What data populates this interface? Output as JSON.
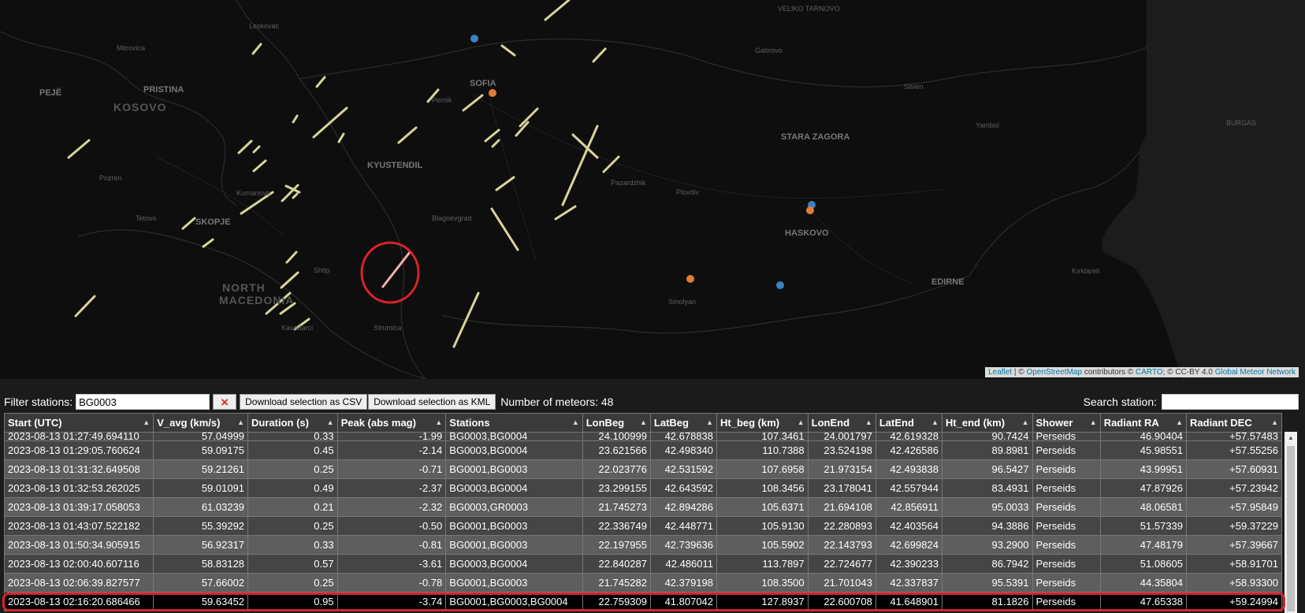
{
  "map": {
    "attribution": {
      "leaflet": "Leaflet",
      "sep1": " | © ",
      "osm": "OpenStreetMap",
      "contributors": " contributors © ",
      "carto": "CARTO",
      "license": "; © CC-BY 4.0 ",
      "gmn": "Global Meteor Network"
    },
    "labels": {
      "veliko": "VELIKO TARNOVO",
      "leskovac": "Leskovac",
      "mitrovica": "Mitrovica",
      "gabrovo": "Gabrovo",
      "pristina": "PRISTINA",
      "peje": "PEJË",
      "kosovo": "KOSOVO",
      "sofia": "SOFIA",
      "pernik": "Pernik",
      "sliven": "Sliven",
      "burgas": "BURGAS",
      "yambol": "Yambol",
      "stara": "STARA ZAGORA",
      "kyustendil": "KYUSTENDIL",
      "prizren": "Prizren",
      "kumanovo": "Kumanovo",
      "pazardzhik": "Pazardzhik",
      "plovdiv": "Plovdiv",
      "tetovo": "Tetovo",
      "skopje": "SKOPJE",
      "blagoevgrad": "Blagoevgrad",
      "haskovo": "HASKOVO",
      "shtip": "Shtip",
      "north": "NORTH",
      "macedonia": "MACEDONIA",
      "edirne": "EDIRNE",
      "kirklareli": "Kırklareli",
      "smolyan": "Smolyan",
      "kavadarci": "Kavadarci",
      "strumica": "Strumica"
    }
  },
  "toolbar": {
    "filter_label": "Filter stations:",
    "filter_value": "BG0003",
    "clear_icon": "×",
    "csv_button": "Download selection as CSV",
    "kml_button": "Download selection as KML",
    "count_text": "Number of meteors: 48",
    "search_label": "Search station:",
    "search_value": ""
  },
  "table": {
    "headers": [
      "Start (UTC)",
      "V_avg (km/s)",
      "Duration (s)",
      "Peak (abs mag)",
      "Stations",
      "LonBeg",
      "LatBeg",
      "Ht_beg (km)",
      "LonEnd",
      "LatEnd",
      "Ht_end (km)",
      "Shower",
      "Radiant RA",
      "Radiant DEC"
    ],
    "sort_icon": "▲",
    "partial_row": [
      "2023-08-13 01:27:49.694110",
      "57.04999",
      "0.33",
      "-1.99",
      "BG0003,BG0004",
      "24.100999",
      "42.678838",
      "107.3461",
      "24.001797",
      "42.619328",
      "90.7424",
      "Perseids",
      "46.90404",
      "+57.57483"
    ],
    "rows": [
      [
        "2023-08-13 01:29:05.760624",
        "59.09175",
        "0.45",
        "-2.14",
        "BG0003,BG0004",
        "23.621566",
        "42.498340",
        "110.7388",
        "23.524198",
        "42.426586",
        "89.8981",
        "Perseids",
        "45.98551",
        "+57.55256"
      ],
      [
        "2023-08-13 01:31:32.649508",
        "59.21261",
        "0.25",
        "-0.71",
        "BG0001,BG0003",
        "22.023776",
        "42.531592",
        "107.6958",
        "21.973154",
        "42.493838",
        "96.5427",
        "Perseids",
        "43.99951",
        "+57.60931"
      ],
      [
        "2023-08-13 01:32:53.262025",
        "59.01091",
        "0.49",
        "-2.37",
        "BG0003,BG0004",
        "23.299155",
        "42.643592",
        "108.3456",
        "23.178041",
        "42.557944",
        "83.4931",
        "Perseids",
        "47.87926",
        "+57.23942"
      ],
      [
        "2023-08-13 01:39:17.058053",
        "61.03239",
        "0.21",
        "-2.32",
        "BG0003,GR0003",
        "21.745273",
        "42.894286",
        "105.6371",
        "21.694108",
        "42.856911",
        "95.0033",
        "Perseids",
        "48.06581",
        "+57.95849"
      ],
      [
        "2023-08-13 01:43:07.522182",
        "55.39292",
        "0.25",
        "-0.50",
        "BG0001,BG0003",
        "22.336749",
        "42.448771",
        "105.9130",
        "22.280893",
        "42.403564",
        "94.3886",
        "Perseids",
        "51.57339",
        "+59.37229"
      ],
      [
        "2023-08-13 01:50:34.905915",
        "56.92317",
        "0.33",
        "-0.81",
        "BG0001,BG0003",
        "22.197955",
        "42.739636",
        "105.5902",
        "22.143793",
        "42.699824",
        "93.2900",
        "Perseids",
        "47.48179",
        "+57.39667"
      ],
      [
        "2023-08-13 02:00:40.607116",
        "58.83128",
        "0.57",
        "-3.61",
        "BG0003,BG0004",
        "22.840287",
        "42.486011",
        "113.7897",
        "22.724677",
        "42.390233",
        "86.7942",
        "Perseids",
        "51.08605",
        "+58.91701"
      ],
      [
        "2023-08-13 02:06:39.827577",
        "57.66002",
        "0.25",
        "-0.78",
        "BG0001,BG0003",
        "21.745282",
        "42.379198",
        "108.3500",
        "21.701043",
        "42.337837",
        "95.5391",
        "Perseids",
        "44.35804",
        "+58.93300"
      ]
    ],
    "selected_row": [
      "2023-08-13 02:16:20.686466",
      "59.63452",
      "0.95",
      "-3.74",
      "BG0001,BG0003,BG0004",
      "22.759309",
      "41.807042",
      "127.8937",
      "22.600708",
      "41.648901",
      "81.1826",
      "Perseids",
      "47.65338",
      "+59.24994"
    ]
  },
  "colors": {
    "map_bg": "#0e0e0e",
    "meteor": "#d8d49a",
    "station_blue": "#3b82c4",
    "station_orange": "#e07b39",
    "highlight": "#d8222a"
  }
}
